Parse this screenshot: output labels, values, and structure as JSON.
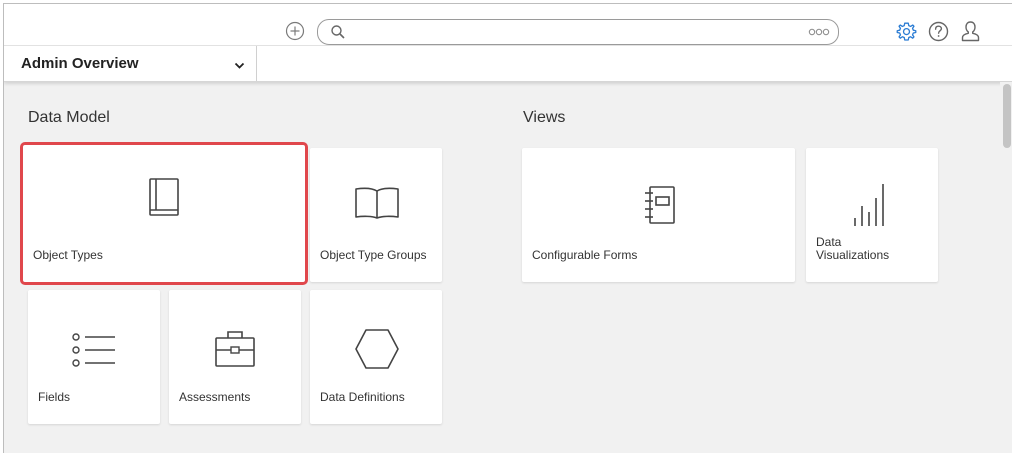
{
  "header": {
    "search": {
      "value": "",
      "placeholder": ""
    }
  },
  "dashboard": {
    "selected": "Admin Overview"
  },
  "sections": {
    "data_model": {
      "title": "Data Model",
      "tiles": {
        "object_types": "Object Types",
        "object_type_groups": "Object Type Groups",
        "fields": "Fields",
        "assessments": "Assessments",
        "data_definitions": "Data Definitions"
      }
    },
    "views": {
      "title": "Views",
      "tiles": {
        "configurable_forms": "Configurable Forms",
        "data_visualizations": "Data Visualizations"
      }
    }
  },
  "colors": {
    "accent": "#2b7cd3",
    "highlight": "#e0474c",
    "icon": "#444444",
    "background": "#f1f1f1"
  },
  "icons": {
    "header": [
      "plus-circle-icon",
      "search-icon",
      "more-icon",
      "gear-icon",
      "help-icon",
      "user-icon"
    ],
    "tiles": [
      "book-icon",
      "open-book-icon",
      "list-icon",
      "briefcase-icon",
      "hexagon-icon",
      "form-notebook-icon",
      "bar-chart-icon"
    ]
  },
  "selected_tile": "object_types"
}
